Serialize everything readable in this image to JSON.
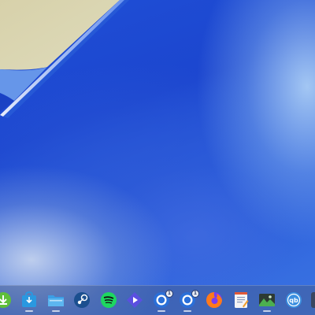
{
  "dock": {
    "items": [
      {
        "id": "download-manager",
        "icon": "download-arrow-icon",
        "running": false
      },
      {
        "id": "store",
        "icon": "store-bag-icon",
        "running": true
      },
      {
        "id": "files",
        "icon": "folder-icon",
        "running": true
      },
      {
        "id": "steam",
        "icon": "steam-icon",
        "running": false
      },
      {
        "id": "spotify",
        "icon": "spotify-icon",
        "running": false
      },
      {
        "id": "media-player",
        "icon": "play-icon",
        "running": false
      },
      {
        "id": "chrome-app-1",
        "icon": "browser-ring-icon",
        "running": true,
        "badge": "1"
      },
      {
        "id": "chrome-app-2",
        "icon": "browser-ring-icon",
        "running": true,
        "badge": "1"
      },
      {
        "id": "firefox",
        "icon": "firefox-icon",
        "running": false
      },
      {
        "id": "text-editor",
        "icon": "notepad-icon",
        "running": false
      },
      {
        "id": "image-viewer",
        "icon": "image-landscape-icon",
        "running": true
      },
      {
        "id": "qbittorrent",
        "icon": "qb-icon",
        "running": false
      },
      {
        "id": "partial-item",
        "icon": "app-icon",
        "running": false
      }
    ]
  },
  "colors": {
    "wallpaper_primary": "#1f4fd6",
    "wallpaper_sand": "#d9d3ad",
    "dock_background": "#465f96"
  }
}
